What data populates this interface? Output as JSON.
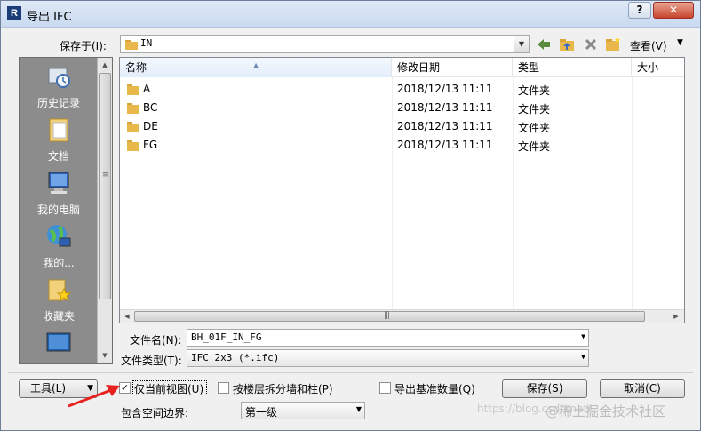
{
  "window": {
    "title": "导出 IFC",
    "help_label": "?",
    "close_label": "✕"
  },
  "save_in": {
    "label": "保存于(I):",
    "value": "IN"
  },
  "toolbar": {
    "views_label": "查看(V)"
  },
  "places": [
    {
      "label": "历史记录",
      "icon": "history-icon"
    },
    {
      "label": "文档",
      "icon": "documents-icon"
    },
    {
      "label": "我的电脑",
      "icon": "computer-icon"
    },
    {
      "label": "我的...",
      "icon": "network-icon"
    },
    {
      "label": "收藏夹",
      "icon": "favorites-icon"
    },
    {
      "label": "",
      "icon": "desktop-icon"
    }
  ],
  "file_list": {
    "columns": [
      "名称",
      "修改日期",
      "类型",
      "大小"
    ],
    "rows": [
      {
        "name": "A",
        "date": "2018/12/13 11:11",
        "type": "文件夹"
      },
      {
        "name": "BC",
        "date": "2018/12/13 11:11",
        "type": "文件夹"
      },
      {
        "name": "DE",
        "date": "2018/12/13 11:11",
        "type": "文件夹"
      },
      {
        "name": "FG",
        "date": "2018/12/13 11:11",
        "type": "文件夹"
      }
    ]
  },
  "file_name": {
    "label": "文件名(N):",
    "value": "BH_01F_IN_FG"
  },
  "file_type": {
    "label": "文件类型(T):",
    "value": "IFC 2x3 (*.ifc)"
  },
  "tools": {
    "label": "工具(L)"
  },
  "options": {
    "current_view": {
      "label": "仅当前视图(U)",
      "checked": true
    },
    "split_walls": {
      "label": "按楼层拆分墙和柱(P)",
      "checked": false
    },
    "base_quantities": {
      "label": "导出基准数量(Q)",
      "checked": false
    }
  },
  "buttons": {
    "save": "保存(S)",
    "cancel": "取消(C)"
  },
  "space_bounds": {
    "label": "包含空间边界:",
    "value": "第一级"
  },
  "watermark": {
    "left": "https://blog.csdn.net/",
    "right": "@稀土掘金技术社区"
  },
  "colors": {
    "accent_arrow": "#e8231f",
    "places_bg": "#8c8c8c",
    "folder": "#e8b84a"
  }
}
